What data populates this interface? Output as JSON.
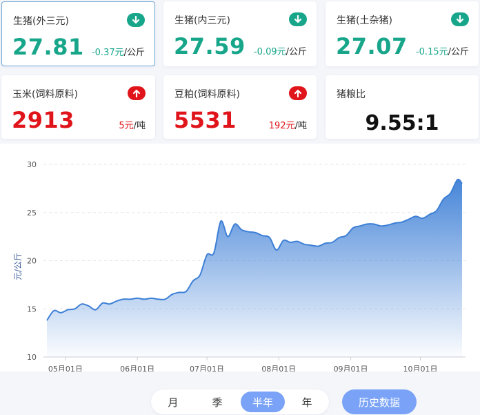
{
  "colors": {
    "down": "#18a68b",
    "up": "#e0151b",
    "accent": "#7aa3f7",
    "line": "#3d7fd6"
  },
  "cards": [
    {
      "title": "生猪(外三元)",
      "value": "27.81",
      "change": "-0.37元",
      "unit": "/公斤",
      "direction": "down",
      "icon": "arrow-down-icon"
    },
    {
      "title": "生猪(内三元)",
      "value": "27.59",
      "change": "-0.09元",
      "unit": "/公斤",
      "direction": "down",
      "icon": "arrow-down-icon"
    },
    {
      "title": "生猪(土杂猪)",
      "value": "27.07",
      "change": "-0.15元",
      "unit": "/公斤",
      "direction": "down",
      "icon": "arrow-down-icon"
    },
    {
      "title": "玉米(饲料原料)",
      "value": "2913",
      "change": "5元",
      "unit": "/吨",
      "direction": "up",
      "icon": "arrow-up-icon"
    },
    {
      "title": "豆粕(饲料原料)",
      "value": "5531",
      "change": "192元",
      "unit": "/吨",
      "direction": "up",
      "icon": "arrow-up-icon"
    },
    {
      "title": "猪粮比",
      "value": "9.55:1"
    }
  ],
  "chart_data": {
    "type": "area",
    "ylabel": "元/公斤",
    "ylim": [
      10,
      30
    ],
    "yticks": [
      10,
      15,
      20,
      25,
      30
    ],
    "grid": true,
    "xticks": [
      "05月01日",
      "06月01日",
      "07月01日",
      "08月01日",
      "09月01日",
      "10月01日"
    ],
    "x_range": [
      "04月23日",
      "10月19日"
    ],
    "x": [
      "04-23",
      "04-26",
      "04-29",
      "05-02",
      "05-05",
      "05-08",
      "05-11",
      "05-14",
      "05-17",
      "05-20",
      "05-23",
      "05-26",
      "05-29",
      "06-01",
      "06-04",
      "06-07",
      "06-10",
      "06-13",
      "06-16",
      "06-19",
      "06-22",
      "06-25",
      "06-28",
      "07-01",
      "07-04",
      "07-07",
      "07-10",
      "07-13",
      "07-16",
      "07-19",
      "07-22",
      "07-25",
      "07-28",
      "07-31",
      "08-03",
      "08-06",
      "08-09",
      "08-12",
      "08-15",
      "08-18",
      "08-21",
      "08-24",
      "08-27",
      "08-30",
      "09-02",
      "09-05",
      "09-08",
      "09-11",
      "09-14",
      "09-17",
      "09-20",
      "09-23",
      "09-26",
      "09-29",
      "10-02",
      "10-05",
      "10-08",
      "10-11",
      "10-14",
      "10-17",
      "10-19"
    ],
    "values": [
      13.8,
      14.8,
      14.6,
      14.9,
      15.0,
      15.5,
      15.3,
      14.9,
      15.6,
      15.5,
      15.8,
      16.0,
      16.0,
      16.1,
      16.0,
      16.1,
      16.0,
      16.0,
      16.5,
      16.7,
      16.8,
      17.9,
      18.5,
      20.6,
      20.8,
      24.1,
      22.5,
      23.8,
      23.2,
      23.0,
      22.9,
      22.6,
      22.4,
      21.1,
      22.1,
      21.9,
      22.0,
      21.7,
      21.6,
      21.5,
      21.8,
      21.9,
      22.4,
      22.6,
      23.4,
      23.6,
      23.8,
      23.8,
      23.6,
      23.7,
      23.9,
      24.0,
      24.3,
      24.6,
      24.4,
      24.8,
      25.2,
      26.4,
      27.0,
      28.4,
      28.0
    ]
  },
  "tabs": [
    {
      "label": "月",
      "active": false
    },
    {
      "label": "季",
      "active": false
    },
    {
      "label": "半年",
      "active": true
    },
    {
      "label": "年",
      "active": false
    }
  ],
  "history_button": "历史数据"
}
